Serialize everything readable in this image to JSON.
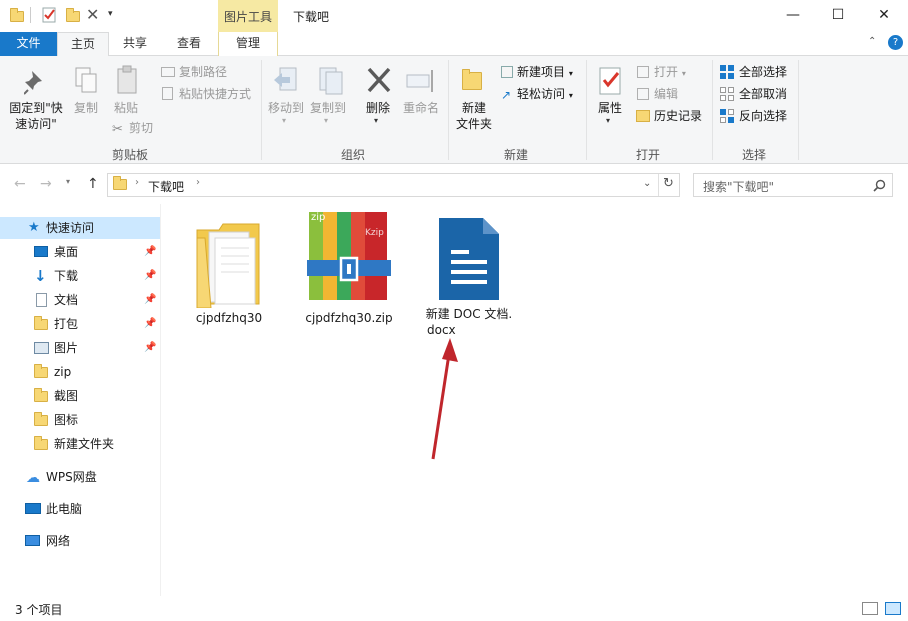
{
  "window": {
    "title": "下载吧",
    "context_tab_group": "图片工具",
    "controls": {
      "minimize": "—",
      "maximize": "☐",
      "close": "✕"
    }
  },
  "tabs": {
    "file": "文件",
    "home": "主页",
    "share": "共享",
    "view": "查看",
    "manage": "管理"
  },
  "ribbon": {
    "clipboard": {
      "label": "剪贴板",
      "pin_line1": "固定到\"快",
      "pin_line2": "速访问\"",
      "copy": "复制",
      "paste": "粘贴",
      "copy_path": "复制路径",
      "paste_shortcut": "粘贴快捷方式",
      "cut": "剪切"
    },
    "organize": {
      "label": "组织",
      "move_to": "移动到",
      "copy_to": "复制到",
      "delete": "删除",
      "rename": "重命名"
    },
    "new": {
      "label": "新建",
      "new_folder_line1": "新建",
      "new_folder_line2": "文件夹",
      "new_item": "新建项目",
      "easy_access": "轻松访问"
    },
    "open": {
      "label": "打开",
      "properties": "属性",
      "open": "打开",
      "edit": "编辑",
      "history": "历史记录"
    },
    "select": {
      "label": "选择",
      "select_all": "全部选择",
      "select_none": "全部取消",
      "invert": "反向选择"
    }
  },
  "address": {
    "crumb": "下载吧",
    "search_placeholder": "搜索\"下载吧\""
  },
  "sidebar": {
    "quick_access": "快速访问",
    "items": [
      {
        "label": "桌面",
        "pinned": true,
        "icon": "desktop-icon"
      },
      {
        "label": "下载",
        "pinned": true,
        "icon": "download-icon"
      },
      {
        "label": "文档",
        "pinned": true,
        "icon": "document-icon"
      },
      {
        "label": "打包",
        "pinned": true,
        "icon": "folder-icon"
      },
      {
        "label": "图片",
        "pinned": true,
        "icon": "pictures-icon"
      },
      {
        "label": "zip",
        "pinned": false,
        "icon": "folder-icon"
      },
      {
        "label": "截图",
        "pinned": false,
        "icon": "folder-icon"
      },
      {
        "label": "图标",
        "pinned": false,
        "icon": "folder-icon"
      },
      {
        "label": "新建文件夹",
        "pinned": false,
        "icon": "folder-icon"
      }
    ],
    "wps": "WPS网盘",
    "this_pc": "此电脑",
    "network": "网络"
  },
  "files": [
    {
      "name": "cjpdfzhq30",
      "type": "folder"
    },
    {
      "name": "cjpdfzhq30.zip",
      "type": "zip"
    },
    {
      "name_line1": "新建 DOC 文档.",
      "name_line2": "docx",
      "type": "docx"
    }
  ],
  "zip_badges": {
    "left": "zip",
    "right": "Kzip"
  },
  "status": {
    "count": "3 个项目"
  },
  "colors": {
    "accent": "#1979ca",
    "context_tab": "#f6e9a3",
    "selected": "#cce8ff",
    "arrow": "#c0262c"
  }
}
